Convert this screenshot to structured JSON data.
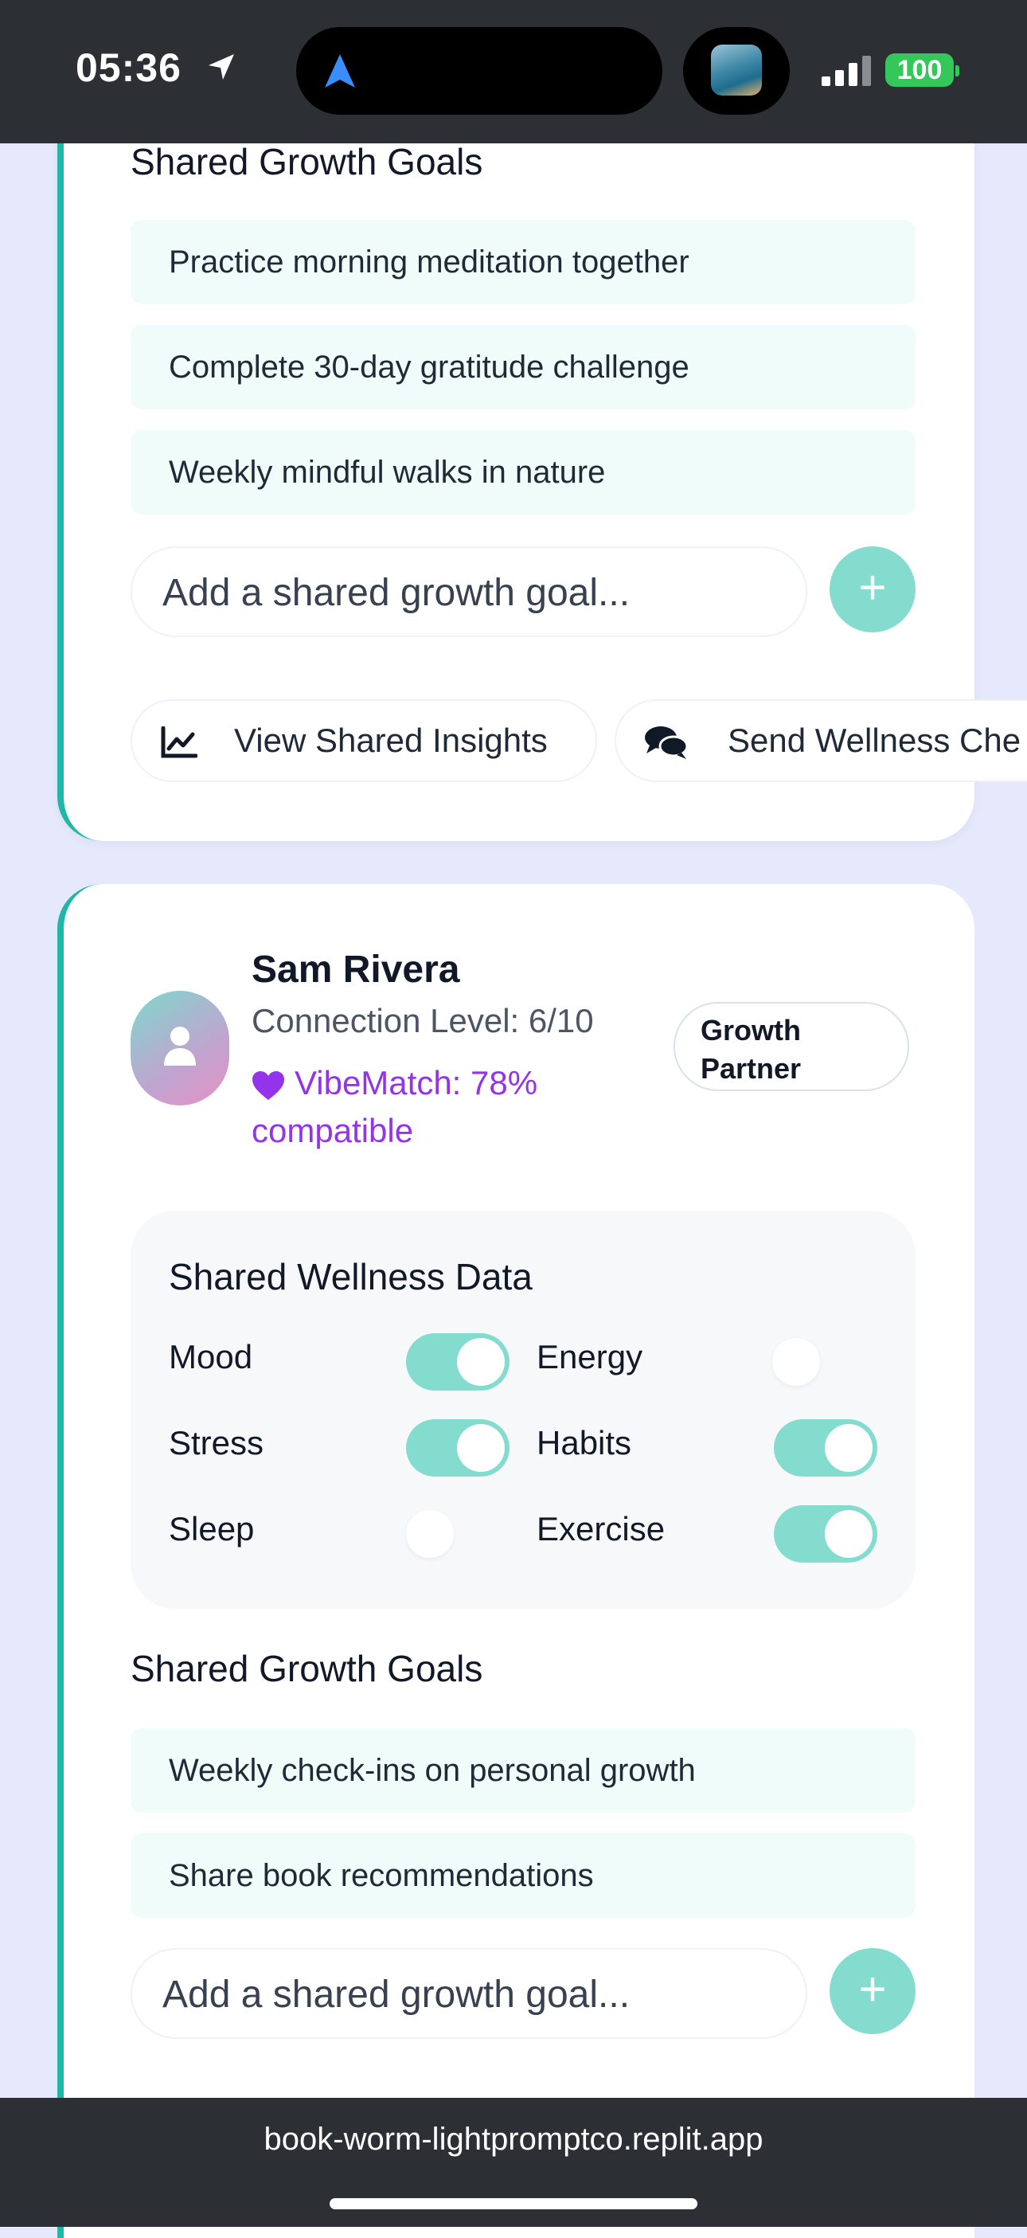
{
  "status_bar": {
    "time": "05:36",
    "battery": "100"
  },
  "card1": {
    "goals_title": "Shared Growth Goals",
    "goals": [
      "Practice morning meditation together",
      "Complete 30-day gratitude challenge",
      "Weekly mindful walks in nature"
    ],
    "goal_placeholder": "Add a shared growth goal...",
    "add_symbol": "+",
    "actions": {
      "insights": "View Shared Insights",
      "checkin": "Send Wellness Che"
    }
  },
  "card2": {
    "name": "Sam Rivera",
    "connection": "Connection Level: 6/10",
    "vibematch": "VibeMatch: 78% compatible",
    "badge": "Growth Partner",
    "wellness": {
      "title": "Shared Wellness Data",
      "toggles": [
        {
          "label": "Mood",
          "on": true
        },
        {
          "label": "Energy",
          "on": false
        },
        {
          "label": "Stress",
          "on": true
        },
        {
          "label": "Habits",
          "on": true
        },
        {
          "label": "Sleep",
          "on": false
        },
        {
          "label": "Exercise",
          "on": true
        }
      ]
    },
    "goals_title": "Shared Growth Goals",
    "goals": [
      "Weekly check-ins on personal growth",
      "Share book recommendations"
    ],
    "goal_placeholder": "Add a shared growth goal...",
    "add_symbol": "+"
  },
  "browser": {
    "url": "book-worm-lightpromptco.replit.app"
  },
  "colors": {
    "accent": "#1fb8a6",
    "toggle_on": "#84dccf",
    "vibe": "#9333ea",
    "background": "#e6e9fb"
  }
}
